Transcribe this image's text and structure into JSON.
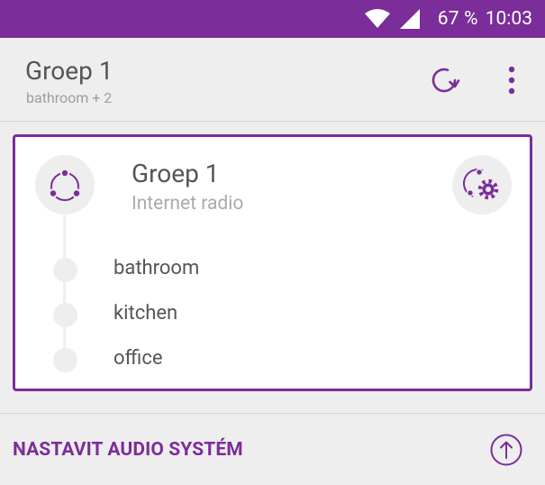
{
  "status_bar": {
    "battery": "67 %",
    "time": "10:03",
    "icons": [
      "wifi-icon",
      "cellular-signal-icon"
    ]
  },
  "app_bar": {
    "title": "Groep 1",
    "subtitle": "bathroom + 2",
    "icons": [
      "refresh-icon",
      "more-vert-icon"
    ]
  },
  "group_card": {
    "name": "Groep 1",
    "source": "Internet radio",
    "icons": [
      "group-icon",
      "group-settings-icon"
    ],
    "rooms": [
      {
        "label": "bathroom"
      },
      {
        "label": "kitchen"
      },
      {
        "label": "office"
      }
    ]
  },
  "footer": {
    "setup_label": "NASTAVIT AUDIO SYSTÉM",
    "icons": [
      "arrow-up-icon"
    ]
  },
  "colors": {
    "accent": "#7b2d9a",
    "background": "#eeeeee",
    "card": "#ffffff",
    "text_primary": "#555555",
    "text_secondary": "#9e9e9e"
  }
}
